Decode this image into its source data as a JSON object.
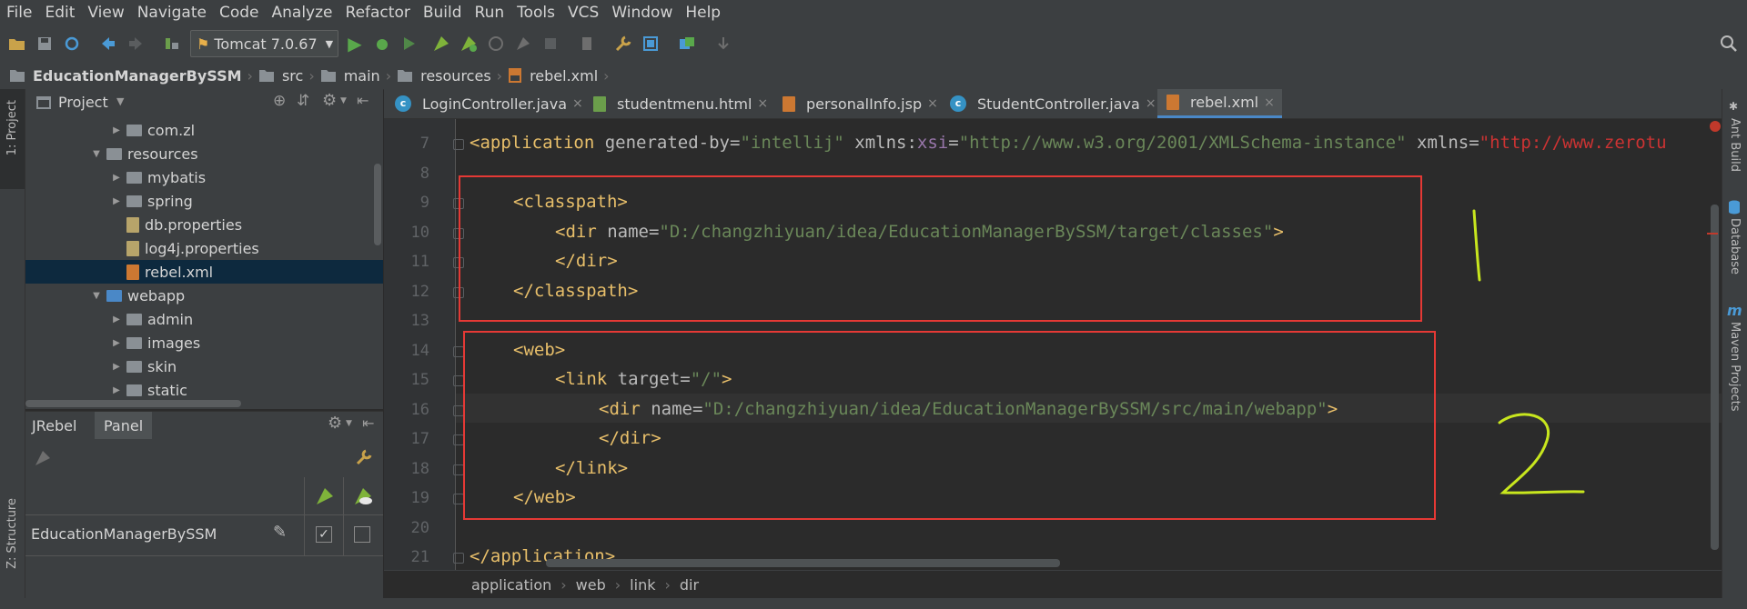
{
  "menu": [
    "File",
    "Edit",
    "View",
    "Navigate",
    "Code",
    "Analyze",
    "Refactor",
    "Build",
    "Run",
    "Tools",
    "VCS",
    "Window",
    "Help"
  ],
  "toolbar": {
    "run_config": "Tomcat 7.0.67"
  },
  "breadcrumb": [
    "EducationManagerBySSM",
    "src",
    "main",
    "resources",
    "rebel.xml"
  ],
  "left_stripe": {
    "project_tab": "1: Project",
    "structure_tab": "Z: Structure"
  },
  "project_panel": {
    "title": "Project",
    "tree": [
      {
        "label": "com.zl",
        "type": "folder",
        "expanded": false
      },
      {
        "label": "resources",
        "type": "folder",
        "expanded": true
      },
      {
        "label": "mybatis",
        "type": "folder",
        "expanded": false
      },
      {
        "label": "spring",
        "type": "folder",
        "expanded": false
      },
      {
        "label": "db.properties",
        "type": "properties"
      },
      {
        "label": "log4j.properties",
        "type": "properties"
      },
      {
        "label": "rebel.xml",
        "type": "xml",
        "selected": true
      },
      {
        "label": "webapp",
        "type": "folder",
        "expanded": true
      },
      {
        "label": "admin",
        "type": "folder",
        "expanded": false
      },
      {
        "label": "images",
        "type": "folder",
        "expanded": false
      },
      {
        "label": "skin",
        "type": "folder",
        "expanded": false
      },
      {
        "label": "static",
        "type": "folder",
        "expanded": false
      }
    ]
  },
  "jrebel_panel": {
    "tab_jrebel": "JRebel",
    "tab_panel": "Panel",
    "row_label": "EducationManagerBySSM",
    "jrebel_checked": true,
    "remote_checked": false
  },
  "tabs": [
    {
      "label": "LoginController.java",
      "icon": "class-icon",
      "active": false
    },
    {
      "label": "studentmenu.html",
      "icon": "html-icon",
      "active": false
    },
    {
      "label": "personalInfo.jsp",
      "icon": "jsp-icon",
      "active": false
    },
    {
      "label": "StudentController.java",
      "icon": "class-icon",
      "active": false
    },
    {
      "label": "rebel.xml",
      "icon": "xml-icon",
      "active": true
    }
  ],
  "editor": {
    "lines": [
      {
        "n": "7"
      },
      {
        "n": "8"
      },
      {
        "n": "9"
      },
      {
        "n": "10"
      },
      {
        "n": "11"
      },
      {
        "n": "12"
      },
      {
        "n": "13"
      },
      {
        "n": "14"
      },
      {
        "n": "15"
      },
      {
        "n": "16"
      },
      {
        "n": "17"
      },
      {
        "n": "18"
      },
      {
        "n": "19"
      },
      {
        "n": "20"
      },
      {
        "n": "21"
      }
    ],
    "code": {
      "l7_tag": "<application",
      "l7_a1": " generated-by=",
      "l7_v1": "\"intellij\"",
      "l7_a2": " xmlns:",
      "l7_ns": "xsi",
      "l7_eq": "=",
      "l7_v2": "\"http://www.w3.org/2001/XMLSchema-instance\"",
      "l7_a3": " xmlns=",
      "l7_v3": "\"http://www.zerotu",
      "l9": "<classpath>",
      "l10_tag": "<dir",
      "l10_a": " name=",
      "l10_v": "\"D:/changzhiyuan/idea/EducationManagerBySSM/target/classes\"",
      "l10_end": ">",
      "l11": "</dir>",
      "l12": "</classpath>",
      "l14": "<web>",
      "l15_tag": "<link",
      "l15_a": " target=",
      "l15_v": "\"/\"",
      "l15_end": ">",
      "l16_tag": "<dir",
      "l16_a": " name=",
      "l16_v": "\"D:/changzhiyuan/idea/EducationManagerBySSM/src/main/webapp\"",
      "l16_end": ">",
      "l17": "</dir>",
      "l18": "</link>",
      "l19": "</web>",
      "l21": "</application>"
    },
    "annotation_1": "1",
    "annotation_2": "2"
  },
  "editor_breadcrumb": [
    "application",
    "web",
    "link",
    "dir"
  ],
  "right_stripe": [
    "Ant Build",
    "Database",
    "Maven Projects"
  ],
  "colors": {
    "highlight_box": "#e53935",
    "annotation": "#c8e61e",
    "accent": "#4a88c7"
  }
}
